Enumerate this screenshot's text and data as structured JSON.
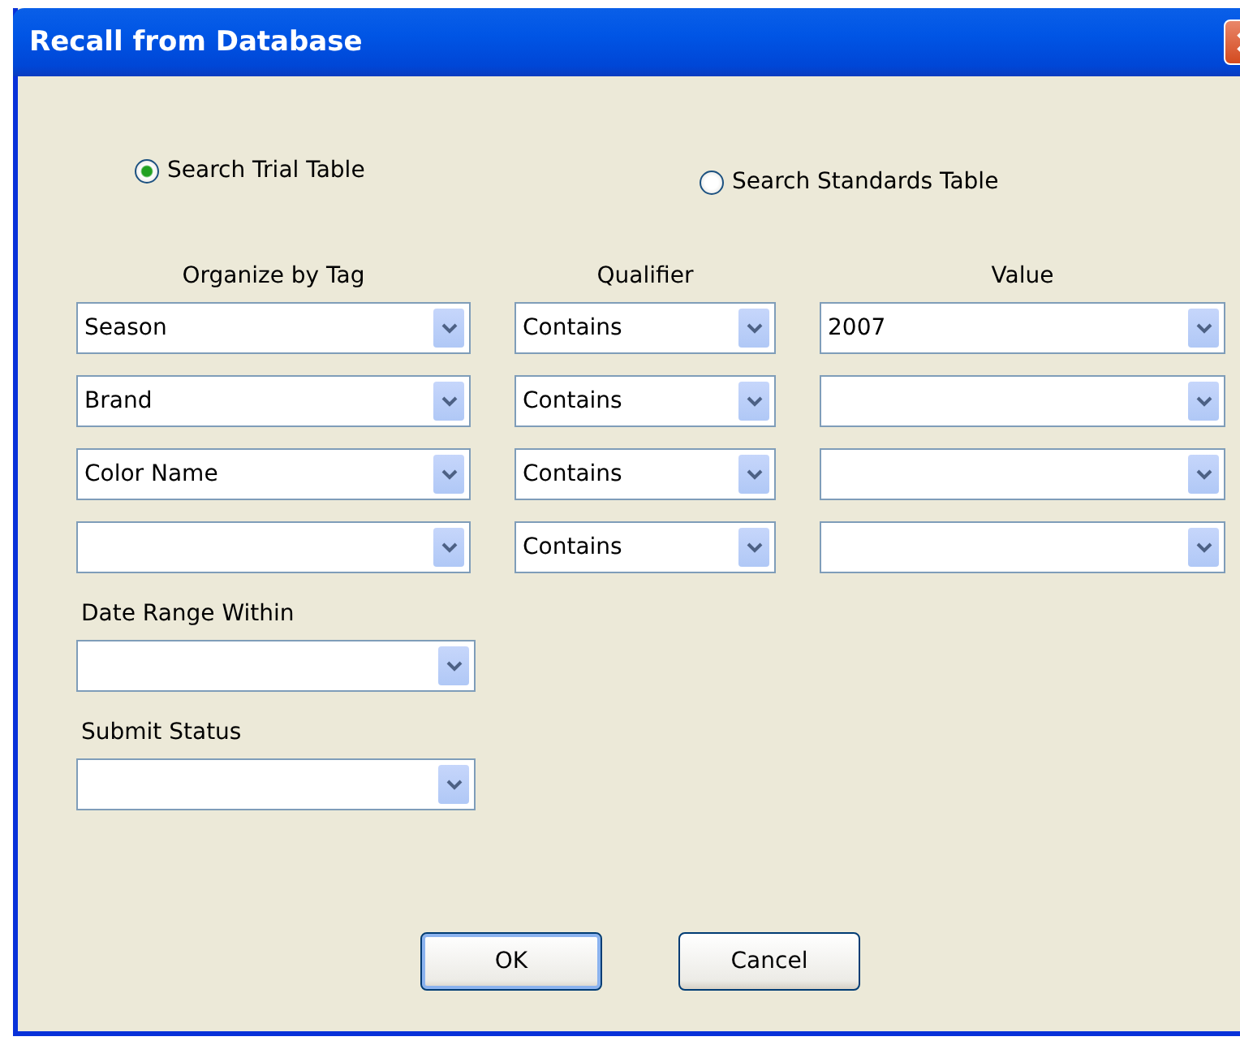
{
  "window": {
    "title": "Recall from Database"
  },
  "search_table": [
    {
      "label": "Search Trial Table",
      "selected": true
    },
    {
      "label": "Search Standards Table",
      "selected": false
    }
  ],
  "columns": [
    "Organize by Tag",
    "Qualifier",
    "Value"
  ],
  "rows": [
    {
      "tag": "Season",
      "qualifier": "Contains",
      "value": "2007"
    },
    {
      "tag": "Brand",
      "qualifier": "Contains"
    },
    {
      "tag": "Color Name",
      "qualifier": "Contains"
    },
    {
      "qualifier": "Contains"
    }
  ],
  "date_range": {
    "label": "Date Range Within"
  },
  "submit_status": {
    "label": "Submit Status"
  },
  "buttons": [
    {
      "label": "OK",
      "default": true
    },
    {
      "label": "Cancel",
      "default": false
    }
  ]
}
